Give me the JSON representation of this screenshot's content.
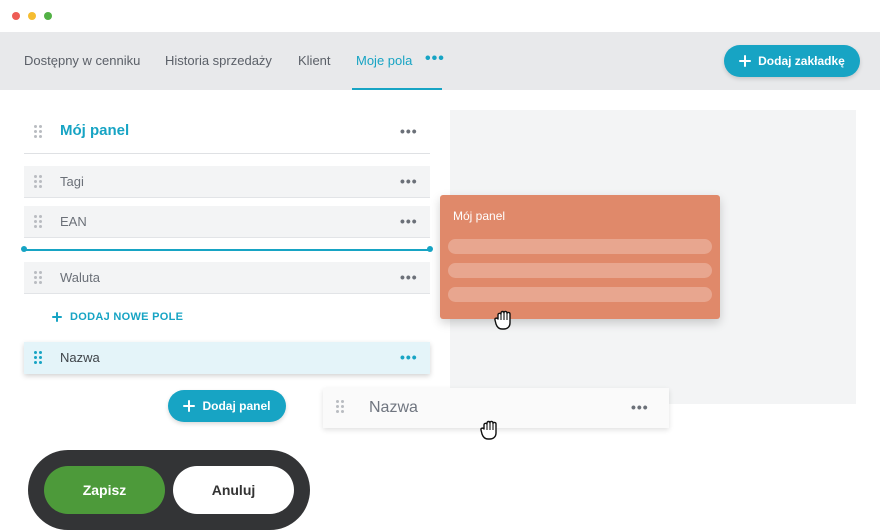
{
  "window": {
    "controls": [
      {
        "name": "close",
        "color": "#ee5c55"
      },
      {
        "name": "minimize",
        "color": "#f5bd31"
      },
      {
        "name": "maximize",
        "color": "#52b145"
      }
    ]
  },
  "tabs": [
    {
      "label": "Dostępny w cenniku",
      "active": false
    },
    {
      "label": "Historia sprzedaży",
      "active": false
    },
    {
      "label": "Klient",
      "active": false
    },
    {
      "label": "Moje pola",
      "active": true
    }
  ],
  "tab_more": "•••",
  "add_tab_button": {
    "label": "Dodaj zakładkę"
  },
  "panel": {
    "title": "Mój panel",
    "menu": "•••",
    "fields": [
      {
        "label": "Tagi",
        "menu": "•••"
      },
      {
        "label": "EAN",
        "menu": "•••"
      },
      {
        "label": "Waluta",
        "menu": "•••"
      }
    ],
    "add_field_label": "DODAJ NOWE POLE",
    "selected_field": {
      "label": "Nazwa",
      "menu": "•••"
    }
  },
  "add_panel_button": {
    "label": "Dodaj panel"
  },
  "dragged_panel": {
    "title": "Mój panel"
  },
  "dragged_field": {
    "label": "Nazwa",
    "menu": "•••"
  },
  "actions": {
    "save_label": "Zapisz",
    "cancel_label": "Anuluj"
  },
  "colors": {
    "accent": "#17a4c4",
    "save": "#4d9a3a",
    "dragged_panel": "#e0896a",
    "action_bar": "#333436"
  }
}
